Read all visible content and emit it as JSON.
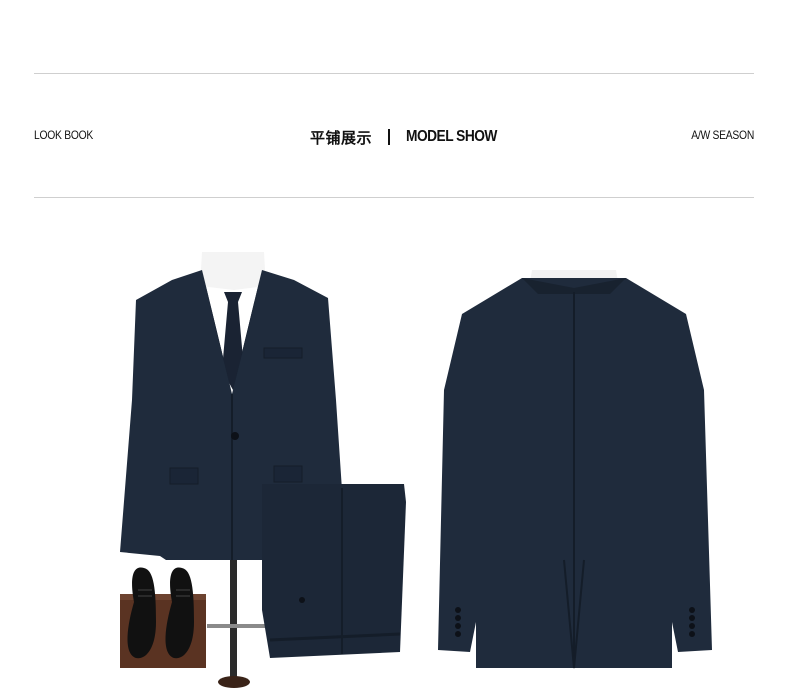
{
  "header": {
    "left_label": "LOOK BOOK",
    "title_cn": "平铺展示",
    "title_en": "MODEL SHOW",
    "right_label": "A/W SEASON"
  },
  "colors": {
    "rule": "#cfcfcf",
    "suit_navy": "#1f2b3c",
    "suit_shadow": "#141d29",
    "shirt_white": "#f4f4f4",
    "stand_wood": "#5a3322"
  },
  "images": {
    "front": "suit-front-flatlay-image",
    "back": "suit-back-image"
  }
}
